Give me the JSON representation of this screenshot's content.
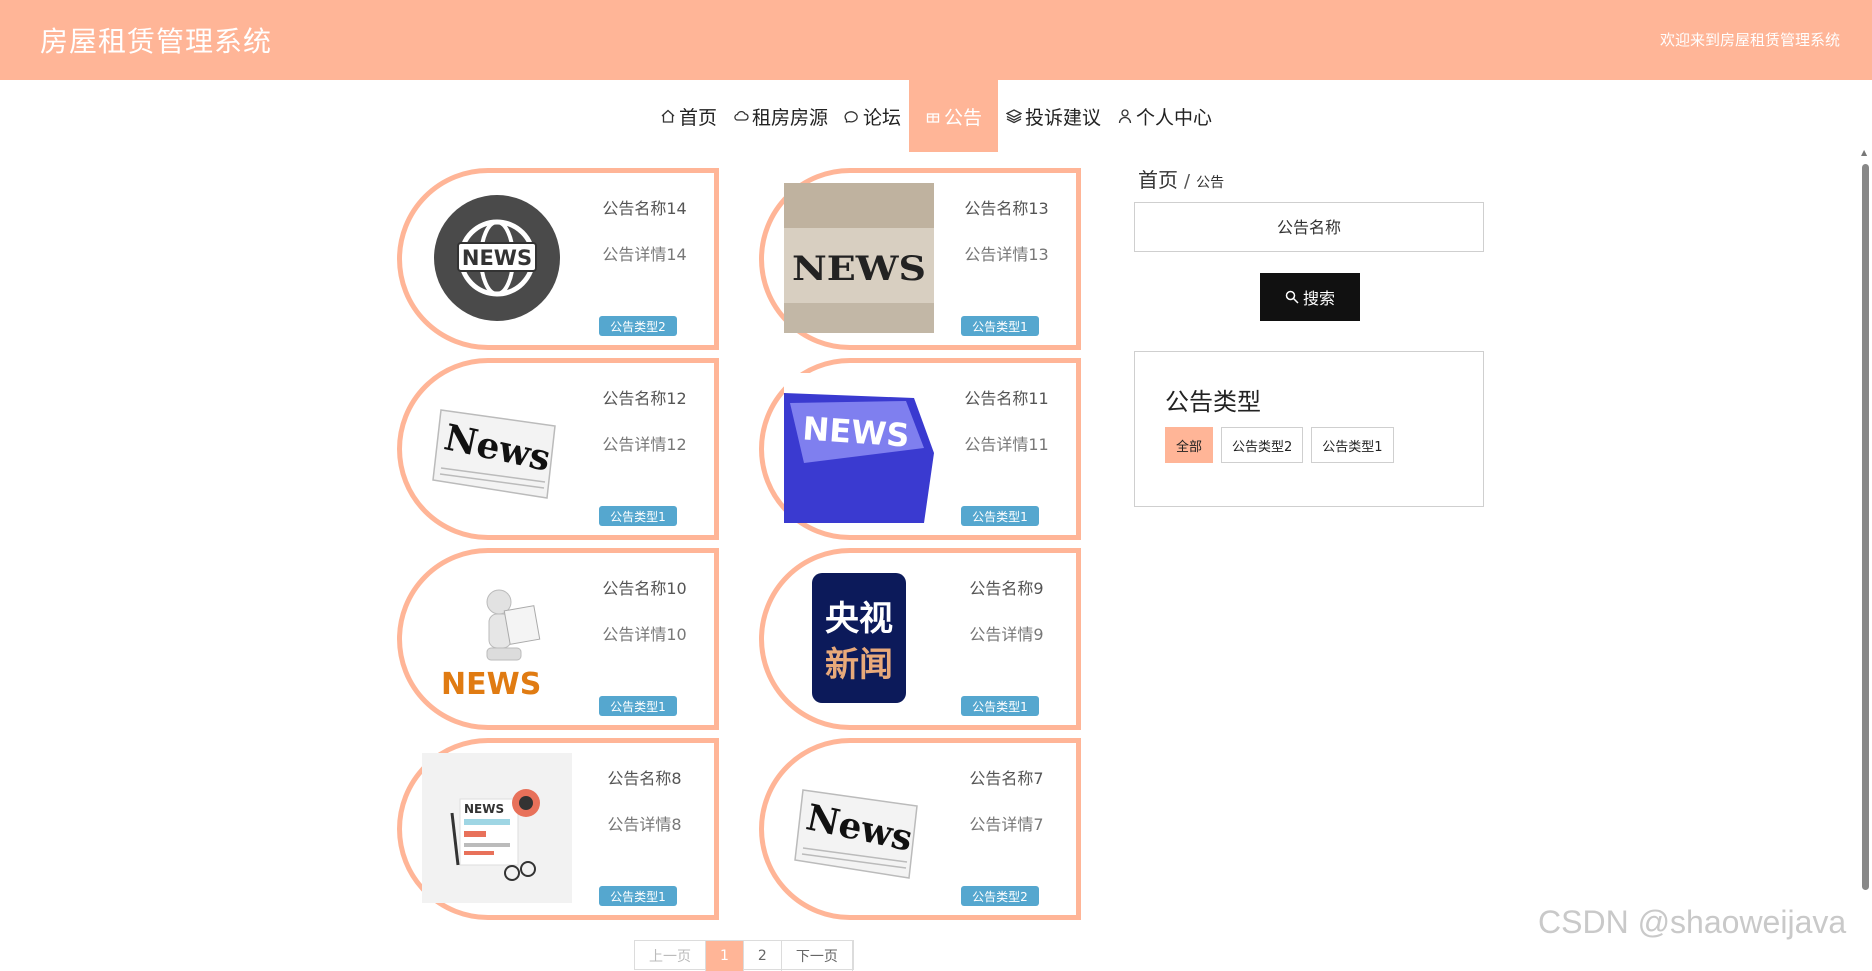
{
  "header": {
    "site_title": "房屋租赁管理系统",
    "welcome": "欢迎来到房屋租赁管理系统"
  },
  "nav": {
    "items": [
      {
        "label": "首页",
        "icon": "home-icon"
      },
      {
        "label": "租房房源",
        "icon": "cloud-icon"
      },
      {
        "label": "论坛",
        "icon": "chat-icon"
      },
      {
        "label": "公告",
        "icon": "gift-icon",
        "active": true
      },
      {
        "label": "投诉建议",
        "icon": "layers-icon"
      },
      {
        "label": "个人中心",
        "icon": "user-icon"
      }
    ]
  },
  "cards": [
    {
      "name": "公告名称14",
      "detail": "公告详情14",
      "type": "公告类型2",
      "image": "globe-news"
    },
    {
      "name": "公告名称13",
      "detail": "公告详情13",
      "type": "公告类型1",
      "image": "news-cubes"
    },
    {
      "name": "公告名称12",
      "detail": "公告详情12",
      "type": "公告类型1",
      "image": "newspaper"
    },
    {
      "name": "公告名称11",
      "detail": "公告详情11",
      "type": "公告类型1",
      "image": "news-key"
    },
    {
      "name": "公告名称10",
      "detail": "公告详情10",
      "type": "公告类型1",
      "image": "reader-figure"
    },
    {
      "name": "公告名称9",
      "detail": "公告详情9",
      "type": "公告类型1",
      "image": "cctv-news"
    },
    {
      "name": "公告名称8",
      "detail": "公告详情8",
      "type": "公告类型1",
      "image": "news-flat"
    },
    {
      "name": "公告名称7",
      "detail": "公告详情7",
      "type": "公告类型2",
      "image": "newspaper"
    }
  ],
  "image_text": {
    "news_upper": "NEWS",
    "news_title": "News",
    "news_small": "NEWS",
    "cctv_line1": "央视",
    "cctv_line2": "新闻"
  },
  "sidebar": {
    "breadcrumb_home": "首页",
    "breadcrumb_sep": "/",
    "breadcrumb_current": "公告",
    "search_placeholder": "公告名称",
    "search_button": "搜索",
    "type_title": "公告类型",
    "types": [
      {
        "label": "全部",
        "active": true
      },
      {
        "label": "公告类型2"
      },
      {
        "label": "公告类型1"
      }
    ]
  },
  "pagination": {
    "prev": "上一页",
    "pages": [
      "1",
      "2"
    ],
    "current": "1",
    "next": "下一页"
  },
  "watermark": "CSDN @shaoweijava",
  "colors": {
    "accent": "#ffb597",
    "tag": "#55a7cf",
    "search_button": "#111111"
  }
}
